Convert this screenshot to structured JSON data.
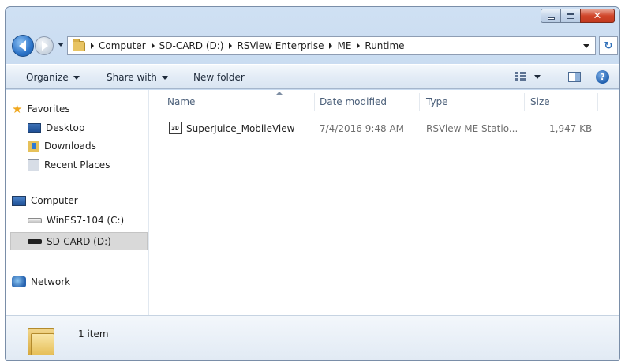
{
  "window": {
    "caption_buttons": {
      "minimize": "–",
      "maximize": "□",
      "close": "✕"
    }
  },
  "address": {
    "crumbs": [
      "Computer",
      "SD-CARD (D:)",
      "RSView Enterprise",
      "ME",
      "Runtime"
    ],
    "refresh_glyph": "↻"
  },
  "toolbar": {
    "organize": "Organize",
    "share_with": "Share with",
    "new_folder": "New folder",
    "help_glyph": "?"
  },
  "nav": {
    "favorites": "Favorites",
    "desktop": "Desktop",
    "downloads": "Downloads",
    "recent_places": "Recent Places",
    "computer": "Computer",
    "drive_c": "WinES7-104 (C:)",
    "drive_d": "SD-CARD (D:)",
    "network": "Network",
    "star_glyph": "★"
  },
  "columns": {
    "name": "Name",
    "date_modified": "Date modified",
    "type": "Type",
    "size": "Size"
  },
  "files": [
    {
      "icon_label": "3D",
      "name": "SuperJuice_MobileView",
      "date_modified": "7/4/2016 9:48 AM",
      "type": "RSView ME Statio...",
      "size": "1,947 KB"
    }
  ],
  "status": {
    "item_count": "1 item"
  },
  "colors": {
    "chrome": "#bcd3ec",
    "selection": "#d9d9d9",
    "close_button": "#d0452a"
  }
}
